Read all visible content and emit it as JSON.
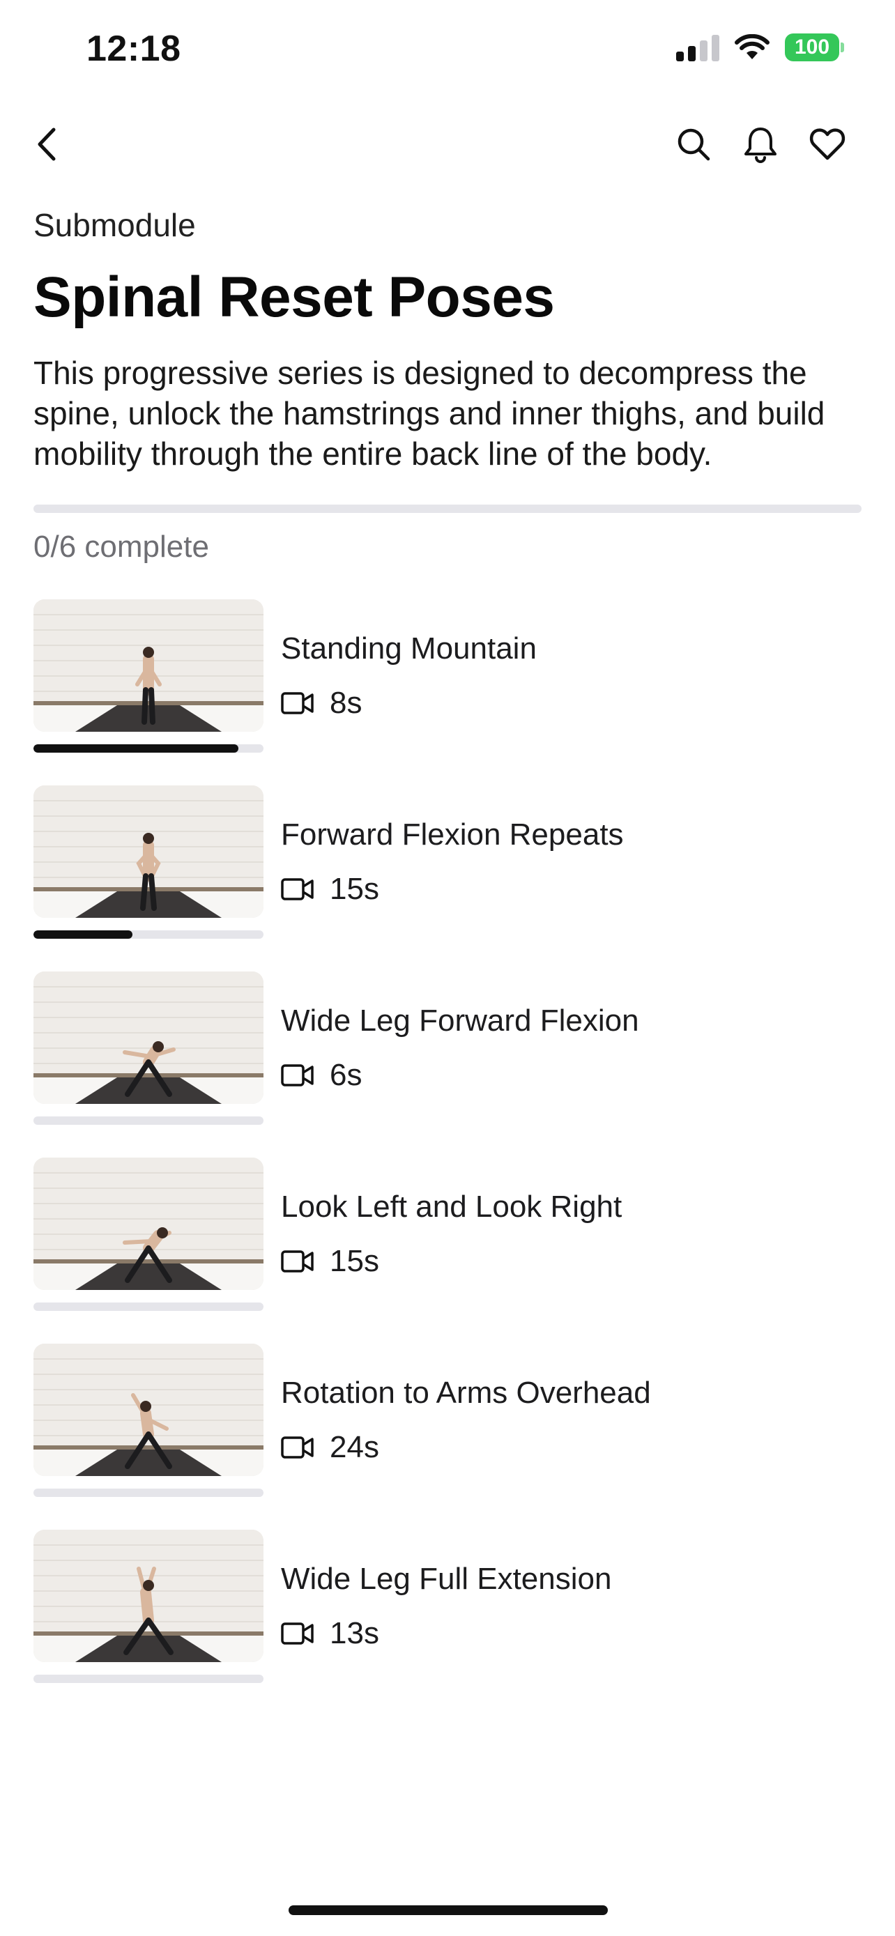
{
  "status_bar": {
    "time": "12:18",
    "battery": "100"
  },
  "nav": {
    "back_icon": "chevron-left-icon",
    "search_icon": "search-icon",
    "bell_icon": "bell-icon",
    "heart_icon": "heart-icon"
  },
  "header": {
    "overline": "Submodule",
    "title": "Spinal Reset Poses",
    "description": "This progressive series is designed to decompress the spine, unlock the hamstrings and inner thighs, and build mobility through the entire back line of the body."
  },
  "progress": {
    "completed": 0,
    "total": 6,
    "label": "0/6 complete"
  },
  "lessons": [
    {
      "title": "Standing Mountain",
      "duration": "8s",
      "watched_fraction": 0.89,
      "pose": "standing"
    },
    {
      "title": "Forward Flexion Repeats",
      "duration": "15s",
      "watched_fraction": 0.43,
      "pose": "hands-hips"
    },
    {
      "title": "Wide Leg Forward Flexion",
      "duration": "6s",
      "watched_fraction": 0,
      "pose": "wide-flex"
    },
    {
      "title": "Look Left and Look Right",
      "duration": "15s",
      "watched_fraction": 0,
      "pose": "wide-twist"
    },
    {
      "title": "Rotation to Arms Overhead",
      "duration": "24s",
      "watched_fraction": 0,
      "pose": "rotation"
    },
    {
      "title": "Wide Leg Full Extension",
      "duration": "13s",
      "watched_fraction": 0,
      "pose": "extension"
    }
  ],
  "colors": {
    "accent": "#111111",
    "track": "#e5e5ea",
    "battery": "#34c759",
    "muted_text": "#6e6e73"
  }
}
